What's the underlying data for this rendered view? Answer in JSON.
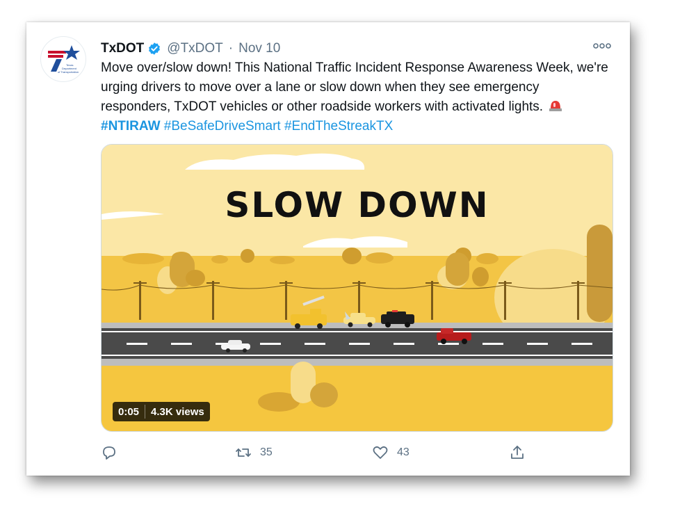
{
  "tweet": {
    "author_name": "TxDOT",
    "handle": "@TxDOT",
    "separator": "·",
    "date": "Nov 10",
    "text_main": "Move over/slow down! This National Traffic Incident Response Awareness Week, we're urging drivers to move over a lane or slow down when they see emergency responders, TxDOT vehicles or other roadside workers with activated lights.",
    "hashtags": [
      "#NTIRAW",
      "#BeSafeDriveSmart",
      "#EndTheStreakTX"
    ],
    "avatar_text": [
      "Texas",
      "Department",
      "of Transportation"
    ]
  },
  "media": {
    "headline": "SLOW DOWN",
    "time": "0:05",
    "views": "4.3K views"
  },
  "actions": {
    "reply": {
      "icon": "reply-icon",
      "count": ""
    },
    "retweet": {
      "icon": "retweet-icon",
      "count": "35"
    },
    "like": {
      "icon": "heart-icon",
      "count": "43"
    },
    "share": {
      "icon": "share-icon",
      "count": ""
    }
  },
  "colors": {
    "hashtag": "#1b95e0",
    "verified": "#1da1f2",
    "scene_yellow": "#f5c63f",
    "sky": "#fbe7a6",
    "road": "#4a4a4a"
  }
}
